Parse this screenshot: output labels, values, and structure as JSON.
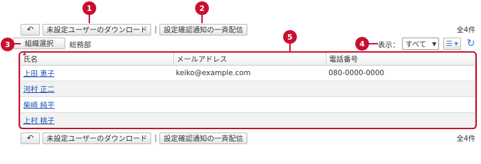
{
  "toolbar": {
    "back_icon": "back-arrow-icon",
    "download_label": "未設定ユーザーのダウンロード",
    "separator": "|",
    "notify_label": "設定確認通知の一斉配信",
    "count": "全4件"
  },
  "filter": {
    "org_select_label": "組織選択",
    "dept": "総務部",
    "display_label": "表示：",
    "display_value": "すべて",
    "view_icon": "list-view-icon",
    "reload_icon": "reload-icon"
  },
  "table": {
    "headers": [
      "氏名",
      "メールアドレス",
      "電話番号"
    ],
    "rows": [
      {
        "name": "上田 恵子",
        "email": "keiko@example.com",
        "phone": "080-0000-0000"
      },
      {
        "name": "河村 正二",
        "email": "",
        "phone": ""
      },
      {
        "name": "柴崎 純平",
        "email": "",
        "phone": ""
      },
      {
        "name": "上村 桃子",
        "email": "",
        "phone": ""
      }
    ]
  },
  "markers": [
    "1",
    "2",
    "3",
    "4",
    "5"
  ],
  "colors": {
    "marker": "#c8102e",
    "link": "#1a4fb5",
    "accent": "#3a7bd5"
  }
}
